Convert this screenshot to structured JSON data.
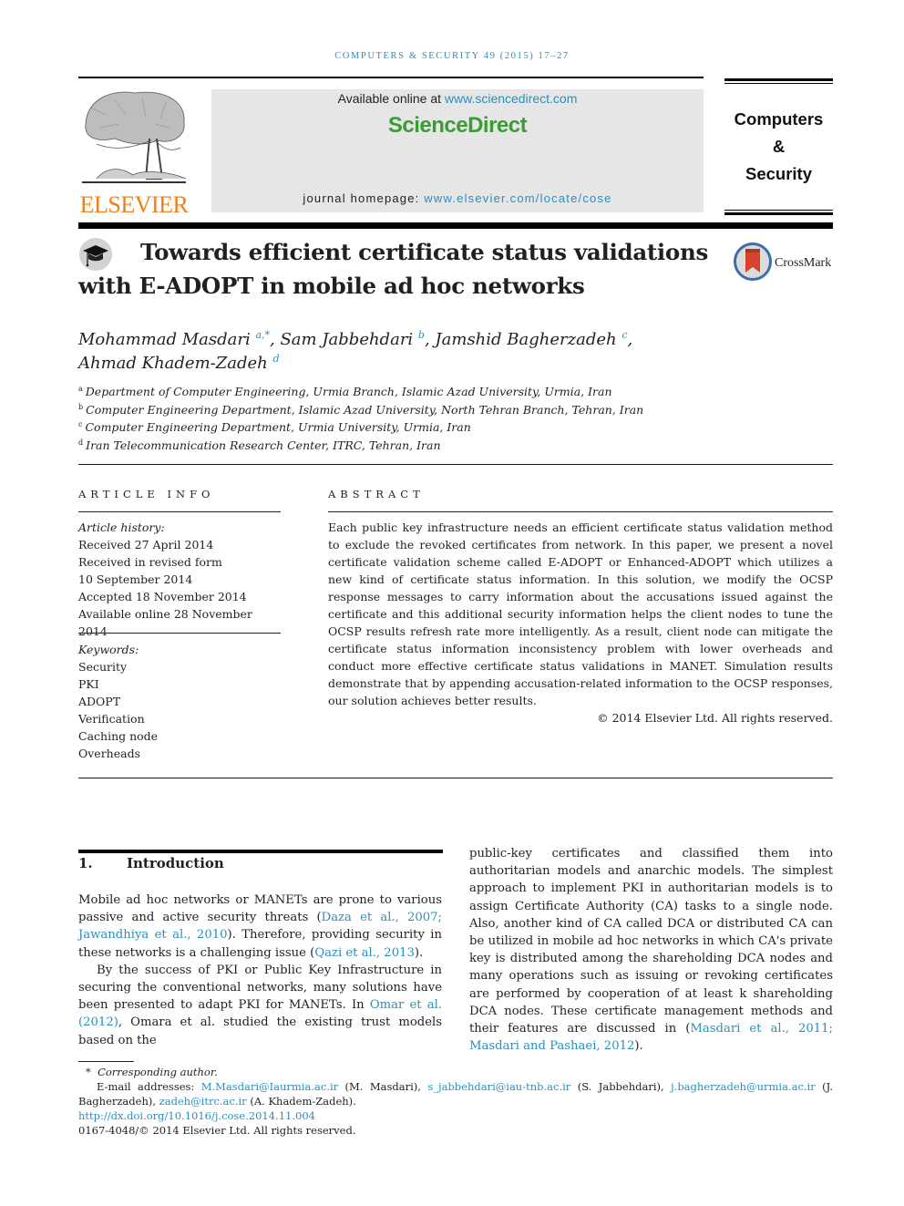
{
  "running_head": "COMPUTERS & SECURITY 49 (2015) 17–27",
  "publisher": {
    "logo_name": "ELSEVIER",
    "logo_color": "#f07f1b"
  },
  "sciencedirect": {
    "available_prefix": "Available online at ",
    "available_link": "www.sciencedirect.com",
    "brand": "ScienceDirect",
    "brand_color": "#3c9b35",
    "homepage_prefix": "journal homepage: ",
    "homepage_link": "www.elsevier.com/locate/cose"
  },
  "journal": {
    "line1": "Computers",
    "line2": "&",
    "line3": "Security"
  },
  "article": {
    "title": "Towards efficient certificate status validations with E-ADOPT in mobile ad hoc networks",
    "crossmark_label": "CrossMark",
    "authors": [
      {
        "name": "Mohammad Masdari",
        "sup": "a,*",
        "sep": ", "
      },
      {
        "name": "Sam Jabbehdari",
        "sup": "b",
        "sep": ", "
      },
      {
        "name": "Jamshid Bagherzadeh",
        "sup": "c",
        "sep": ","
      },
      {
        "name": "Ahmad Khadem-Zadeh",
        "sup": "d",
        "sep": ""
      }
    ],
    "affiliations": [
      {
        "key": "a",
        "text": "Department of Computer Engineering, Urmia Branch, Islamic Azad University, Urmia, Iran"
      },
      {
        "key": "b",
        "text": "Computer Engineering Department, Islamic Azad University, North Tehran Branch, Tehran, Iran"
      },
      {
        "key": "c",
        "text": "Computer Engineering Department, Urmia University, Urmia, Iran"
      },
      {
        "key": "d",
        "text": "Iran Telecommunication Research Center, ITRC, Tehran, Iran"
      }
    ]
  },
  "article_info": {
    "heading": "ARTICLE INFO",
    "history_label": "Article history:",
    "history": [
      "Received 27 April 2014",
      "Received in revised form",
      "10 September 2014",
      "Accepted 18 November 2014",
      "Available online 28 November 2014"
    ],
    "keywords_label": "Keywords:",
    "keywords": [
      "Security",
      "PKI",
      "ADOPT",
      "Verification",
      "Caching node",
      "Overheads"
    ]
  },
  "abstract": {
    "heading": "ABSTRACT",
    "text": "Each public key infrastructure needs an efficient certificate status validation method to exclude the revoked certificates from network. In this paper, we present a novel certificate validation scheme called E-ADOPT or Enhanced-ADOPT which utilizes a new kind of certificate status information. In this solution, we modify the OCSP response messages to carry information about the accusations issued against the certificate and this additional security information helps the client nodes to tune the OCSP results refresh rate more intelligently. As a result, client node can mitigate the certificate status information inconsistency problem with lower overheads and conduct more effective certificate status validations in MANET. Simulation results demonstrate that by appending accusation-related information to the OCSP responses, our solution achieves better results.",
    "copyright": "© 2014 Elsevier Ltd. All rights reserved."
  },
  "introduction": {
    "number": "1.",
    "heading": "Introduction",
    "p1": {
      "t1": "Mobile ad hoc networks or MANETs are prone to various passive and active security threats (",
      "l1": "Daza et al., 2007; Jawandhiya et al., 2010",
      "t2": "). Therefore, providing security in these networks is a challenging issue (",
      "l2": "Qazi et al., 2013",
      "t3": ")."
    },
    "p2": {
      "t1": "By the success of PKI or Public Key Infrastructure in securing the conventional networks, many solutions have been presented to adapt PKI for MANETs. In ",
      "l1": "Omar et al. (2012)",
      "t2": ", Omara et al. studied the existing trust models based on the"
    },
    "p3": {
      "t1": "public-key certificates and classified them into authoritarian models and anarchic models. The simplest approach to implement PKI in authoritarian models is to assign Certificate Authority (CA) tasks to a single node. Also, another kind of CA called DCA or distributed CA can be utilized in mobile ad hoc networks in which CA's private key is distributed among the shareholding DCA nodes and many operations such as issuing or revoking certificates are performed by cooperation of at least k shareholding DCA nodes. These certificate management methods and their features are discussed in (",
      "l1": "Masdari et al., 2011; Masdari and Pashaei, 2012",
      "t2": ")."
    }
  },
  "footnotes": {
    "corresponding": "Corresponding author.",
    "emails_label": "E-mail addresses: ",
    "emails": [
      {
        "email": "M.Masdari@Iaurmia.ac.ir",
        "who": " (M. Masdari), "
      },
      {
        "email": "s_jabbehdari@iau-tnb.ac.ir",
        "who": " (S. Jabbehdari), "
      },
      {
        "email": "j.bagherzadeh@urmia.ac.ir",
        "who": " (J. Bagherzadeh), "
      },
      {
        "email": "zadeh@itrc.ac.ir",
        "who": " (A. Khadem-Zadeh)."
      }
    ],
    "doi": "http://dx.doi.org/10.1016/j.cose.2014.11.004",
    "issn_copyright": "0167-4048/© 2014 Elsevier Ltd. All rights reserved."
  },
  "link_color": "#2a8fbd"
}
